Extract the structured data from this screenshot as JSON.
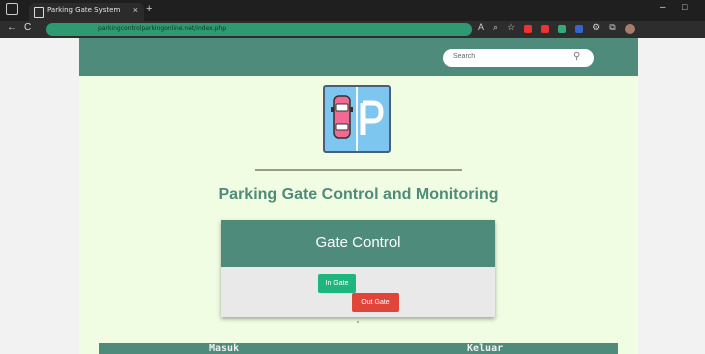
{
  "browser": {
    "tab_title": "Parking Gate System",
    "url": "parkingcontrolparkingonline.net/index.php",
    "tab_close_glyph": "×",
    "new_tab_glyph": "+",
    "window_minimize_glyph": "–",
    "window_maximize_glyph": "□",
    "back_glyph": "←",
    "reload_glyph": "C",
    "toolbar_icons": [
      "read-aloud-icon",
      "zoom-icon",
      "favorites-icon",
      "extension-icon",
      "extension-icon",
      "extension-icon",
      "extension-icon",
      "settings-icon",
      "collections-icon",
      "profile-icon"
    ]
  },
  "header": {
    "search_placeholder": "Search",
    "search_icon_glyph": "⚲"
  },
  "main": {
    "title": "Parking Gate Control and Monitoring"
  },
  "gate_control": {
    "title": "Gate Control",
    "in_gate_label": "In Gate",
    "out_gate_label": "Out Gate"
  },
  "table": {
    "columns": [
      "Masuk",
      "Keluar"
    ]
  },
  "colors": {
    "primary": "#4e8b7a",
    "page_bg": "#f1fde3",
    "in_gate": "#1fb57f",
    "out_gate": "#e0453a",
    "url_bar": "#2f9a72"
  }
}
